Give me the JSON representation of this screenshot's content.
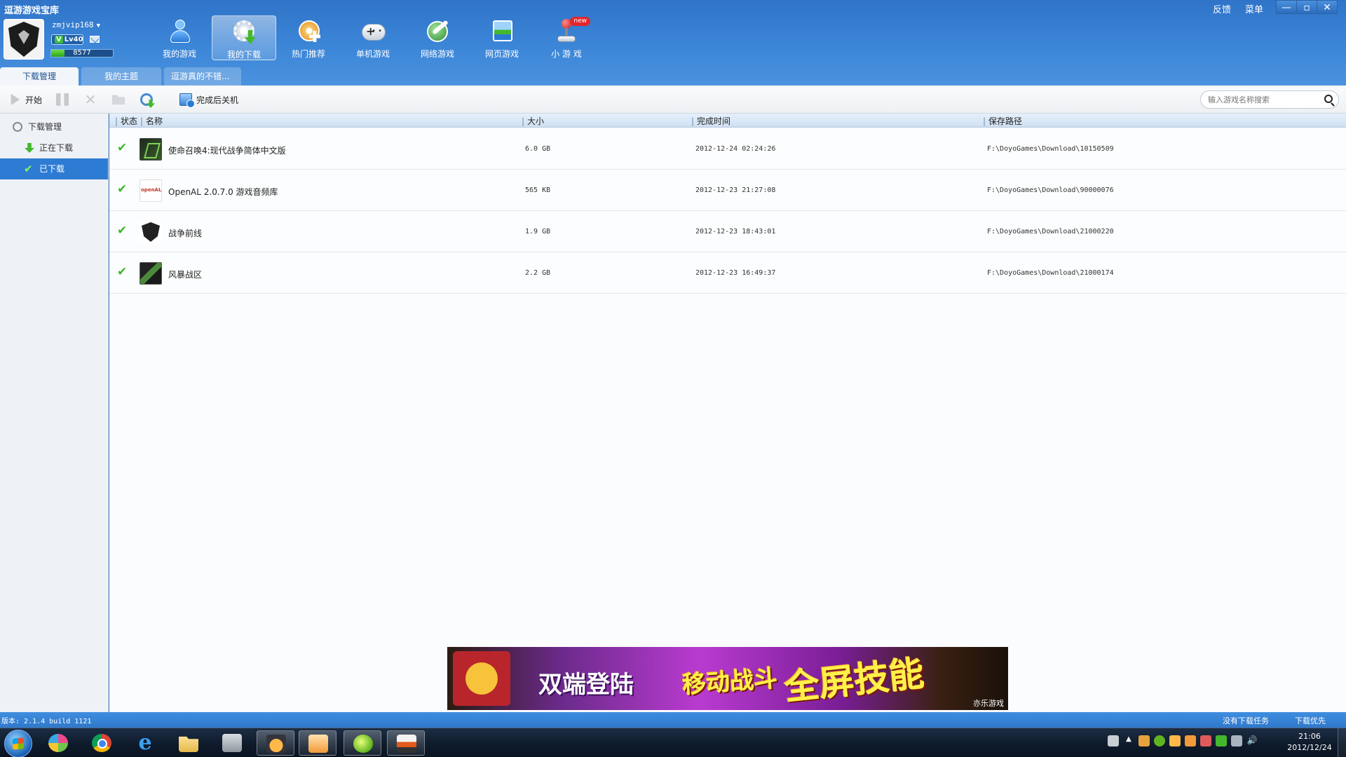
{
  "app": {
    "title": "逗游游戏宝库",
    "top_links": [
      "反馈",
      "菜单"
    ],
    "window_controls": [
      "—",
      "▫",
      "✕"
    ]
  },
  "user": {
    "name": "zmjvip168",
    "level": "Lv40",
    "exp_value": "8577",
    "exp_fraction": 0.22
  },
  "nav": {
    "items": [
      {
        "label": "我的游戏",
        "icon": "person-icon"
      },
      {
        "label": "我的下载",
        "icon": "download-gear-icon",
        "active": true
      },
      {
        "label": "热门推荐",
        "icon": "disc-plus-icon"
      },
      {
        "label": "单机游戏",
        "icon": "gamepad-icon"
      },
      {
        "label": "网络游戏",
        "icon": "globe-sword-icon"
      },
      {
        "label": "网页游戏",
        "icon": "web-page-icon"
      },
      {
        "label": "小 游 戏",
        "icon": "joystick-icon",
        "badge": "new"
      }
    ]
  },
  "tabs": [
    "下载管理",
    "我的主题",
    "逗游真的不错..."
  ],
  "toolbar": {
    "start": "开始",
    "shutdown_after": "完成后关机",
    "search_placeholder": "输入游戏名称搜索"
  },
  "sidebar": {
    "root": "下载管理",
    "downloading": "正在下载",
    "downloaded": "已下载"
  },
  "table": {
    "headers": {
      "status": "状态",
      "name": "名称",
      "size": "大小",
      "finish_time": "完成时间",
      "save_path": "保存路径"
    },
    "rows": [
      {
        "name": "使命召唤4:现代战争简体中文版",
        "size": "6.0 GB",
        "time": "2012-12-24 02:24:26",
        "path": "F:\\DoyoGames\\Download\\10150509",
        "icon": "cod4-game-icon"
      },
      {
        "name": "OpenAL 2.0.7.0 游戏音频库",
        "size": "565 KB",
        "time": "2012-12-23 21:27:08",
        "path": "F:\\DoyoGames\\Download\\90000076",
        "icon": "openal-icon"
      },
      {
        "name": "战争前线",
        "size": "1.9 GB",
        "time": "2012-12-23 18:43:01",
        "path": "F:\\DoyoGames\\Download\\21000220",
        "icon": "shield-game-icon"
      },
      {
        "name": "风暴战区",
        "size": "2.2 GB",
        "time": "2012-12-23 16:49:37",
        "path": "F:\\DoyoGames\\Download\\21000174",
        "icon": "storm-game-icon"
      }
    ]
  },
  "ad": {
    "text1": "双端登陆",
    "text2": "移动战斗",
    "text3": "全屏技能",
    "brand": "亦乐游戏"
  },
  "status": {
    "version": "版本: 2.1.4 build 1121",
    "no_tasks": "没有下载任务",
    "priority": "下载优先"
  },
  "taskbar": {
    "time": "21:06",
    "date": "2012/12/24"
  }
}
